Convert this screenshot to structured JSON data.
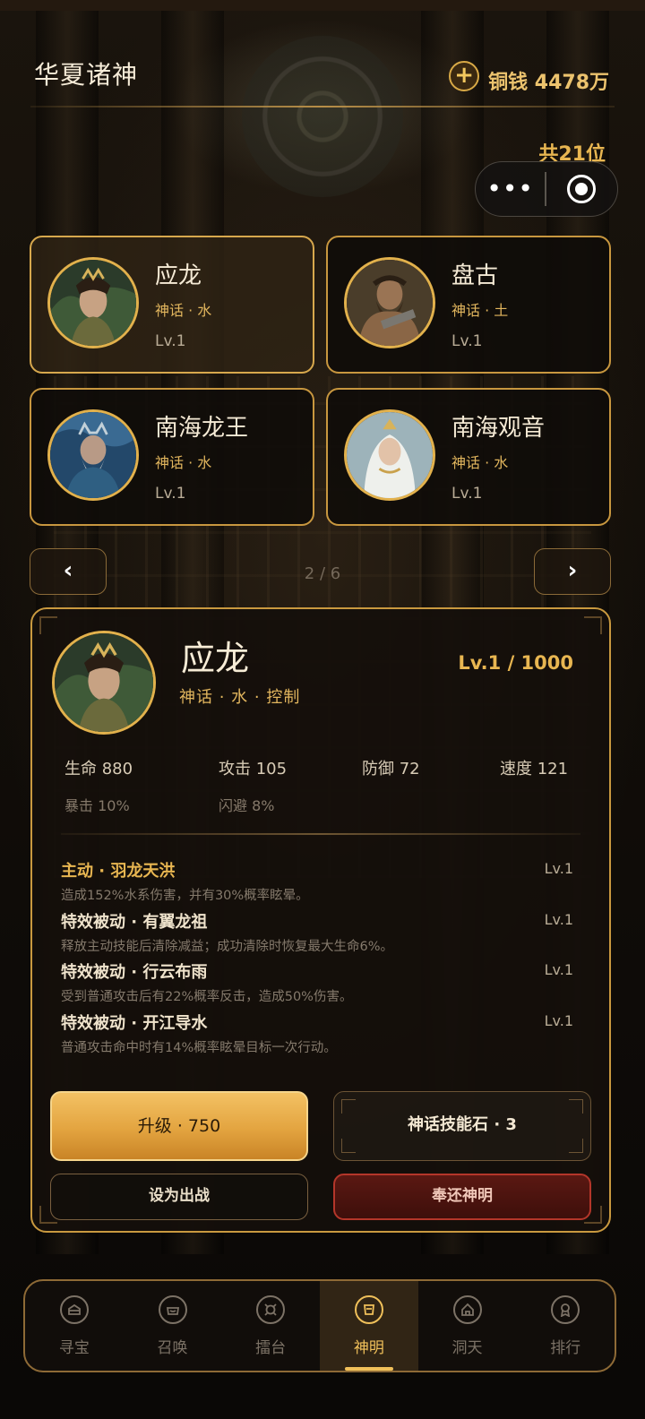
{
  "header": {
    "title": "华夏诸神",
    "coin_icon": "plus-icon",
    "coin_text": "铜钱 4478万",
    "total": "共21位"
  },
  "capsule": {
    "more": "•••",
    "target_icon": "target-icon"
  },
  "gods": [
    {
      "name": "应龙",
      "type": "神话 · 水",
      "level": "Lv.1",
      "selected": true
    },
    {
      "name": "盘古",
      "type": "神话 · 土",
      "level": "Lv.1"
    },
    {
      "name": "南海龙王",
      "type": "神话 · 水",
      "level": "Lv.1"
    },
    {
      "name": "南海观音",
      "type": "神话 · 水",
      "level": "Lv.1"
    }
  ],
  "pager": {
    "prev": "‹",
    "next": "›",
    "text": "2 / 6"
  },
  "detail": {
    "name": "应龙",
    "type": "神话 · 水 · 控制",
    "level": "Lv.1 / 1000",
    "stats": {
      "hp": "生命 880",
      "atk": "攻击 105",
      "def": "防御 72",
      "spd": "速度 121",
      "crit": "暴击 10%",
      "dodge": "闪避 8%"
    },
    "skills": [
      {
        "title": "主动 · 羽龙天洪",
        "level": "Lv.1",
        "desc": "造成152%水系伤害，并有30%概率眩晕。"
      },
      {
        "title": "特效被动 · 有翼龙祖",
        "level": "Lv.1",
        "desc": "释放主动技能后清除减益；成功清除时恢复最大生命6%。"
      },
      {
        "title": "特效被动 · 行云布雨",
        "level": "Lv.1",
        "desc": "受到普通攻击后有22%概率反击，造成50%伤害。"
      },
      {
        "title": "特效被动 · 开江导水",
        "level": "Lv.1",
        "desc": "普通攻击命中时有14%概率眩晕目标一次行动。"
      }
    ],
    "buttons": {
      "upgrade": "升级 · 750",
      "stone": "神话技能石 · 3",
      "deploy": "设为出战",
      "return": "奉还神明"
    }
  },
  "nav": [
    {
      "label": "寻宝",
      "icon": "treasure-icon"
    },
    {
      "label": "召唤",
      "icon": "summon-icon"
    },
    {
      "label": "擂台",
      "icon": "arena-icon"
    },
    {
      "label": "神明",
      "icon": "gods-icon",
      "active": true
    },
    {
      "label": "洞天",
      "icon": "cave-icon"
    },
    {
      "label": "排行",
      "icon": "ranking-icon"
    }
  ],
  "colors": {
    "accent": "#e8b651",
    "border": "#c8973f",
    "danger": "#b4362a"
  }
}
